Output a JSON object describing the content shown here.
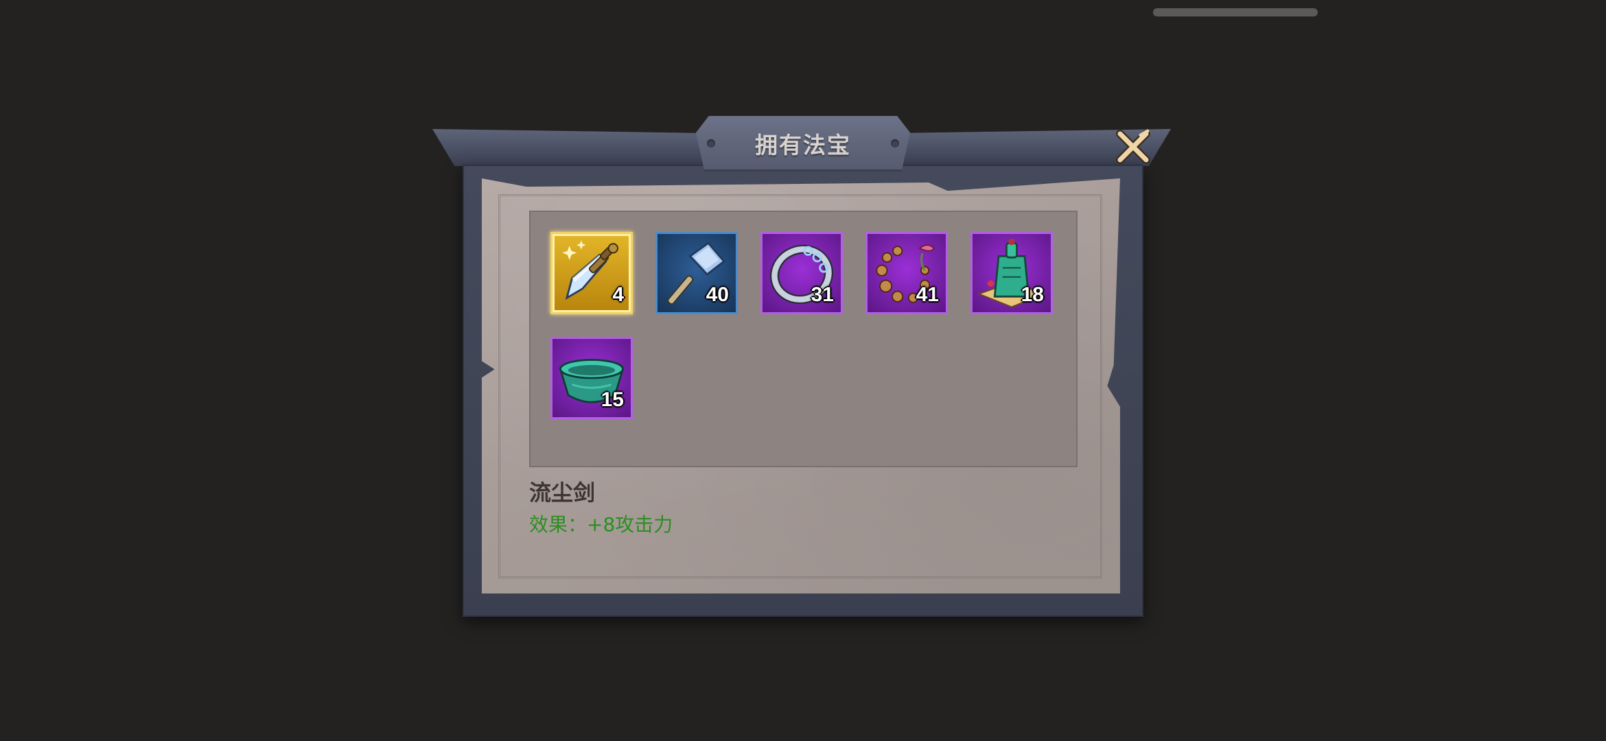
{
  "dialog": {
    "title": "拥有法宝",
    "close_icon": "close-x-icon"
  },
  "items": [
    {
      "icon": "sword-icon",
      "rarity": "gold",
      "count": "4",
      "selected": true
    },
    {
      "icon": "hammer-icon",
      "rarity": "blue",
      "count": "40",
      "selected": false
    },
    {
      "icon": "ring-icon",
      "rarity": "purple",
      "count": "31",
      "selected": false
    },
    {
      "icon": "prayer-beads-icon",
      "rarity": "purple",
      "count": "41",
      "selected": false
    },
    {
      "icon": "jade-seal-icon",
      "rarity": "purple",
      "count": "18",
      "selected": false
    },
    {
      "icon": "jade-bowl-icon",
      "rarity": "purple",
      "count": "15",
      "selected": false
    }
  ],
  "selected_item": {
    "name": "流尘剑",
    "effect": "效果：+8攻击力"
  },
  "colors": {
    "gold": "#e3b629",
    "blue": "#2e5d96",
    "purple": "#9b2fd6",
    "effect_text": "#2a8f1f"
  }
}
